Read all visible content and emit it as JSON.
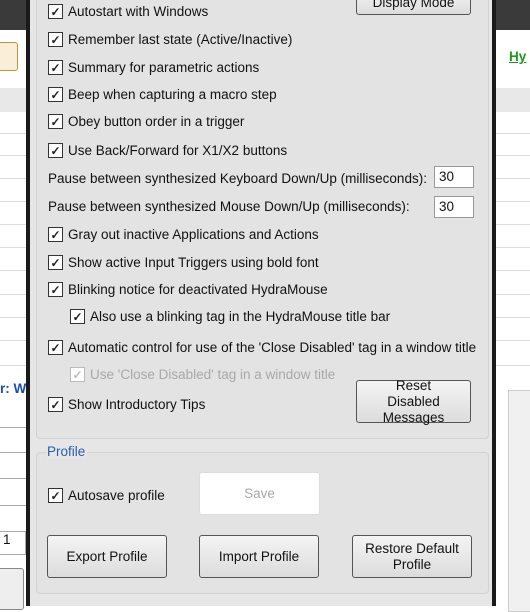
{
  "background": {
    "link_text": "Hy",
    "label_text": "r: W",
    "field_value": "1"
  },
  "options": {
    "top_button": "Display Mode",
    "checkboxes": [
      {
        "label": "Autostart with Windows",
        "checked": true
      },
      {
        "label": "Remember last state (Active/Inactive)",
        "checked": true
      },
      {
        "label": "Summary for parametric actions",
        "checked": true
      },
      {
        "label": "Beep when capturing a macro step",
        "checked": true
      },
      {
        "label": "Obey button order in a trigger",
        "checked": true
      },
      {
        "label": "Use Back/Forward for X1/X2 buttons",
        "checked": true
      }
    ],
    "keyboard_pause_label": "Pause between synthesized Keyboard Down/Up (milliseconds):",
    "keyboard_pause_value": "30",
    "mouse_pause_label": "Pause between synthesized Mouse Down/Up (milliseconds):",
    "mouse_pause_value": "30",
    "checkboxes2": [
      {
        "label": "Gray out inactive Applications and Actions",
        "checked": true
      },
      {
        "label": "Show active Input Triggers using bold font",
        "checked": true
      },
      {
        "label": "Blinking notice for deactivated HydraMouse",
        "checked": true
      },
      {
        "label": "Also use a blinking tag in the HydraMouse title bar",
        "checked": true
      },
      {
        "label": "Automatic control for use of the 'Close Disabled' tag in a window title",
        "checked": true
      },
      {
        "label": "Use 'Close Disabled' tag in a window title",
        "checked": true,
        "disabled": true
      },
      {
        "label": "Show Introductory Tips",
        "checked": true
      }
    ],
    "reset_button": "Reset Disabled Messages"
  },
  "profile": {
    "title": "Profile",
    "autosave_label": "Autosave profile",
    "autosave_checked": true,
    "save_button": "Save",
    "export_button": "Export Profile",
    "import_button": "Import Profile",
    "restore_button": "Restore Default Profile"
  },
  "colors": {
    "profile_title": "#2a5db0",
    "link": "#1a9a1a",
    "label": "#1a4db0"
  }
}
